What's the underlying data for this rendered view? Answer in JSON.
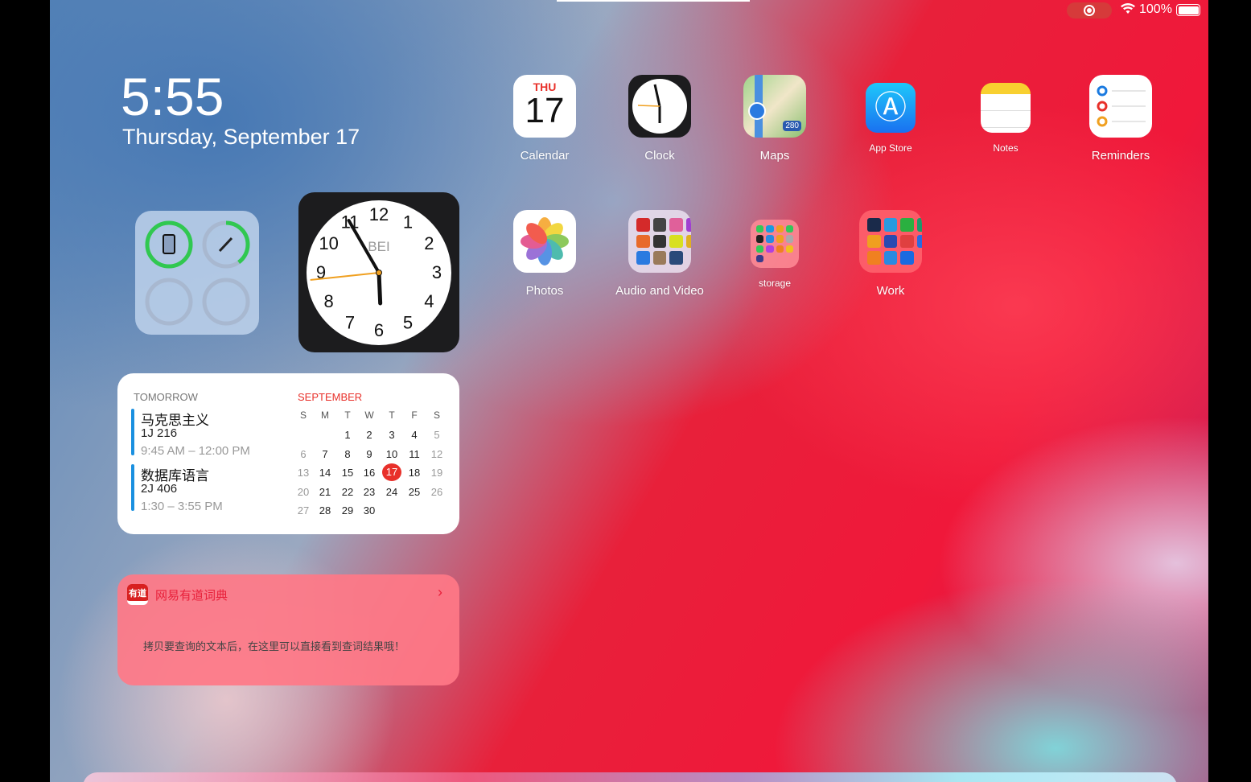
{
  "status_bar": {
    "battery": "100%",
    "wifi_icon": "wifi-icon",
    "recording_icon": "screen-recording-icon"
  },
  "lock": {
    "time": "5:55",
    "date": "Thursday, September 17"
  },
  "apps": [
    {
      "id": "calendar",
      "label": "Calendar",
      "weekday": "THU",
      "day": "17"
    },
    {
      "id": "clock",
      "label": "Clock"
    },
    {
      "id": "maps",
      "label": "Maps",
      "shield": "280"
    },
    {
      "id": "app-store",
      "label": "App Store"
    },
    {
      "id": "notes",
      "label": "Notes"
    },
    {
      "id": "reminders",
      "label": "Reminders"
    },
    {
      "id": "photos",
      "label": "Photos"
    },
    {
      "id": "audio-and-video",
      "label": "Audio and Video"
    },
    {
      "id": "storage",
      "label": "storage"
    },
    {
      "id": "work",
      "label": "Work"
    }
  ],
  "folders": {
    "audio": [
      "#d42a2a",
      "#444",
      "#e0609a",
      "#a040d0",
      "#e86a2a",
      "#333",
      "#d8e020",
      "#e0b020",
      "#2a7ae0",
      "#9a7a5a",
      "#2a4a7a"
    ],
    "storage": [
      "#34c759",
      "#1a9ae0",
      "#f0a020",
      "#34c759",
      "#222",
      "#2a8ae0",
      "#f0a020",
      "#aaa",
      "#34c759",
      "#b040e0",
      "#f08020",
      "#f0c020",
      "#3a3a8a"
    ],
    "work": [
      "#1a2a4a",
      "#2a9ae0",
      "#2ab040",
      "#1a9a6a",
      "#f0a020",
      "#2a4ab0",
      "#e04040",
      "#2a6ae0",
      "#f08020",
      "#2a8ae0",
      "#1a6ae0"
    ]
  },
  "battery_widget": {
    "ipad_level": 1.0,
    "pencil_level": 0.4
  },
  "clock_widget": {
    "city": "BEI",
    "numbers": [
      "12",
      "1",
      "2",
      "3",
      "4",
      "5",
      "6",
      "7",
      "8",
      "9",
      "10",
      "11"
    ],
    "hour": 5,
    "minute": 55,
    "second": 44
  },
  "calendar_widget": {
    "heading": "TOMORROW",
    "events": [
      {
        "title": "马克思主义",
        "location": "1J  216",
        "time": "9:45 AM – 12:00 PM"
      },
      {
        "title": "数据库语言",
        "location": "2J  406",
        "time": "1:30 – 3:55 PM"
      }
    ],
    "month": "SEPTEMBER",
    "weekdays": [
      "S",
      "M",
      "T",
      "W",
      "T",
      "F",
      "S"
    ],
    "weeks": [
      [
        "",
        "",
        "1",
        "2",
        "3",
        "4",
        "5"
      ],
      [
        "6",
        "7",
        "8",
        "9",
        "10",
        "11",
        "12"
      ],
      [
        "13",
        "14",
        "15",
        "16",
        "17",
        "18",
        "19"
      ],
      [
        "20",
        "21",
        "22",
        "23",
        "24",
        "25",
        "26"
      ],
      [
        "27",
        "28",
        "29",
        "30",
        "",
        "",
        ""
      ]
    ],
    "today": "17"
  },
  "dictionary_widget": {
    "app_name": "网易有道词典",
    "icon_text": "有道",
    "message": "拷贝要查询的文本后，在这里可以直接看到查词结果哦！"
  }
}
